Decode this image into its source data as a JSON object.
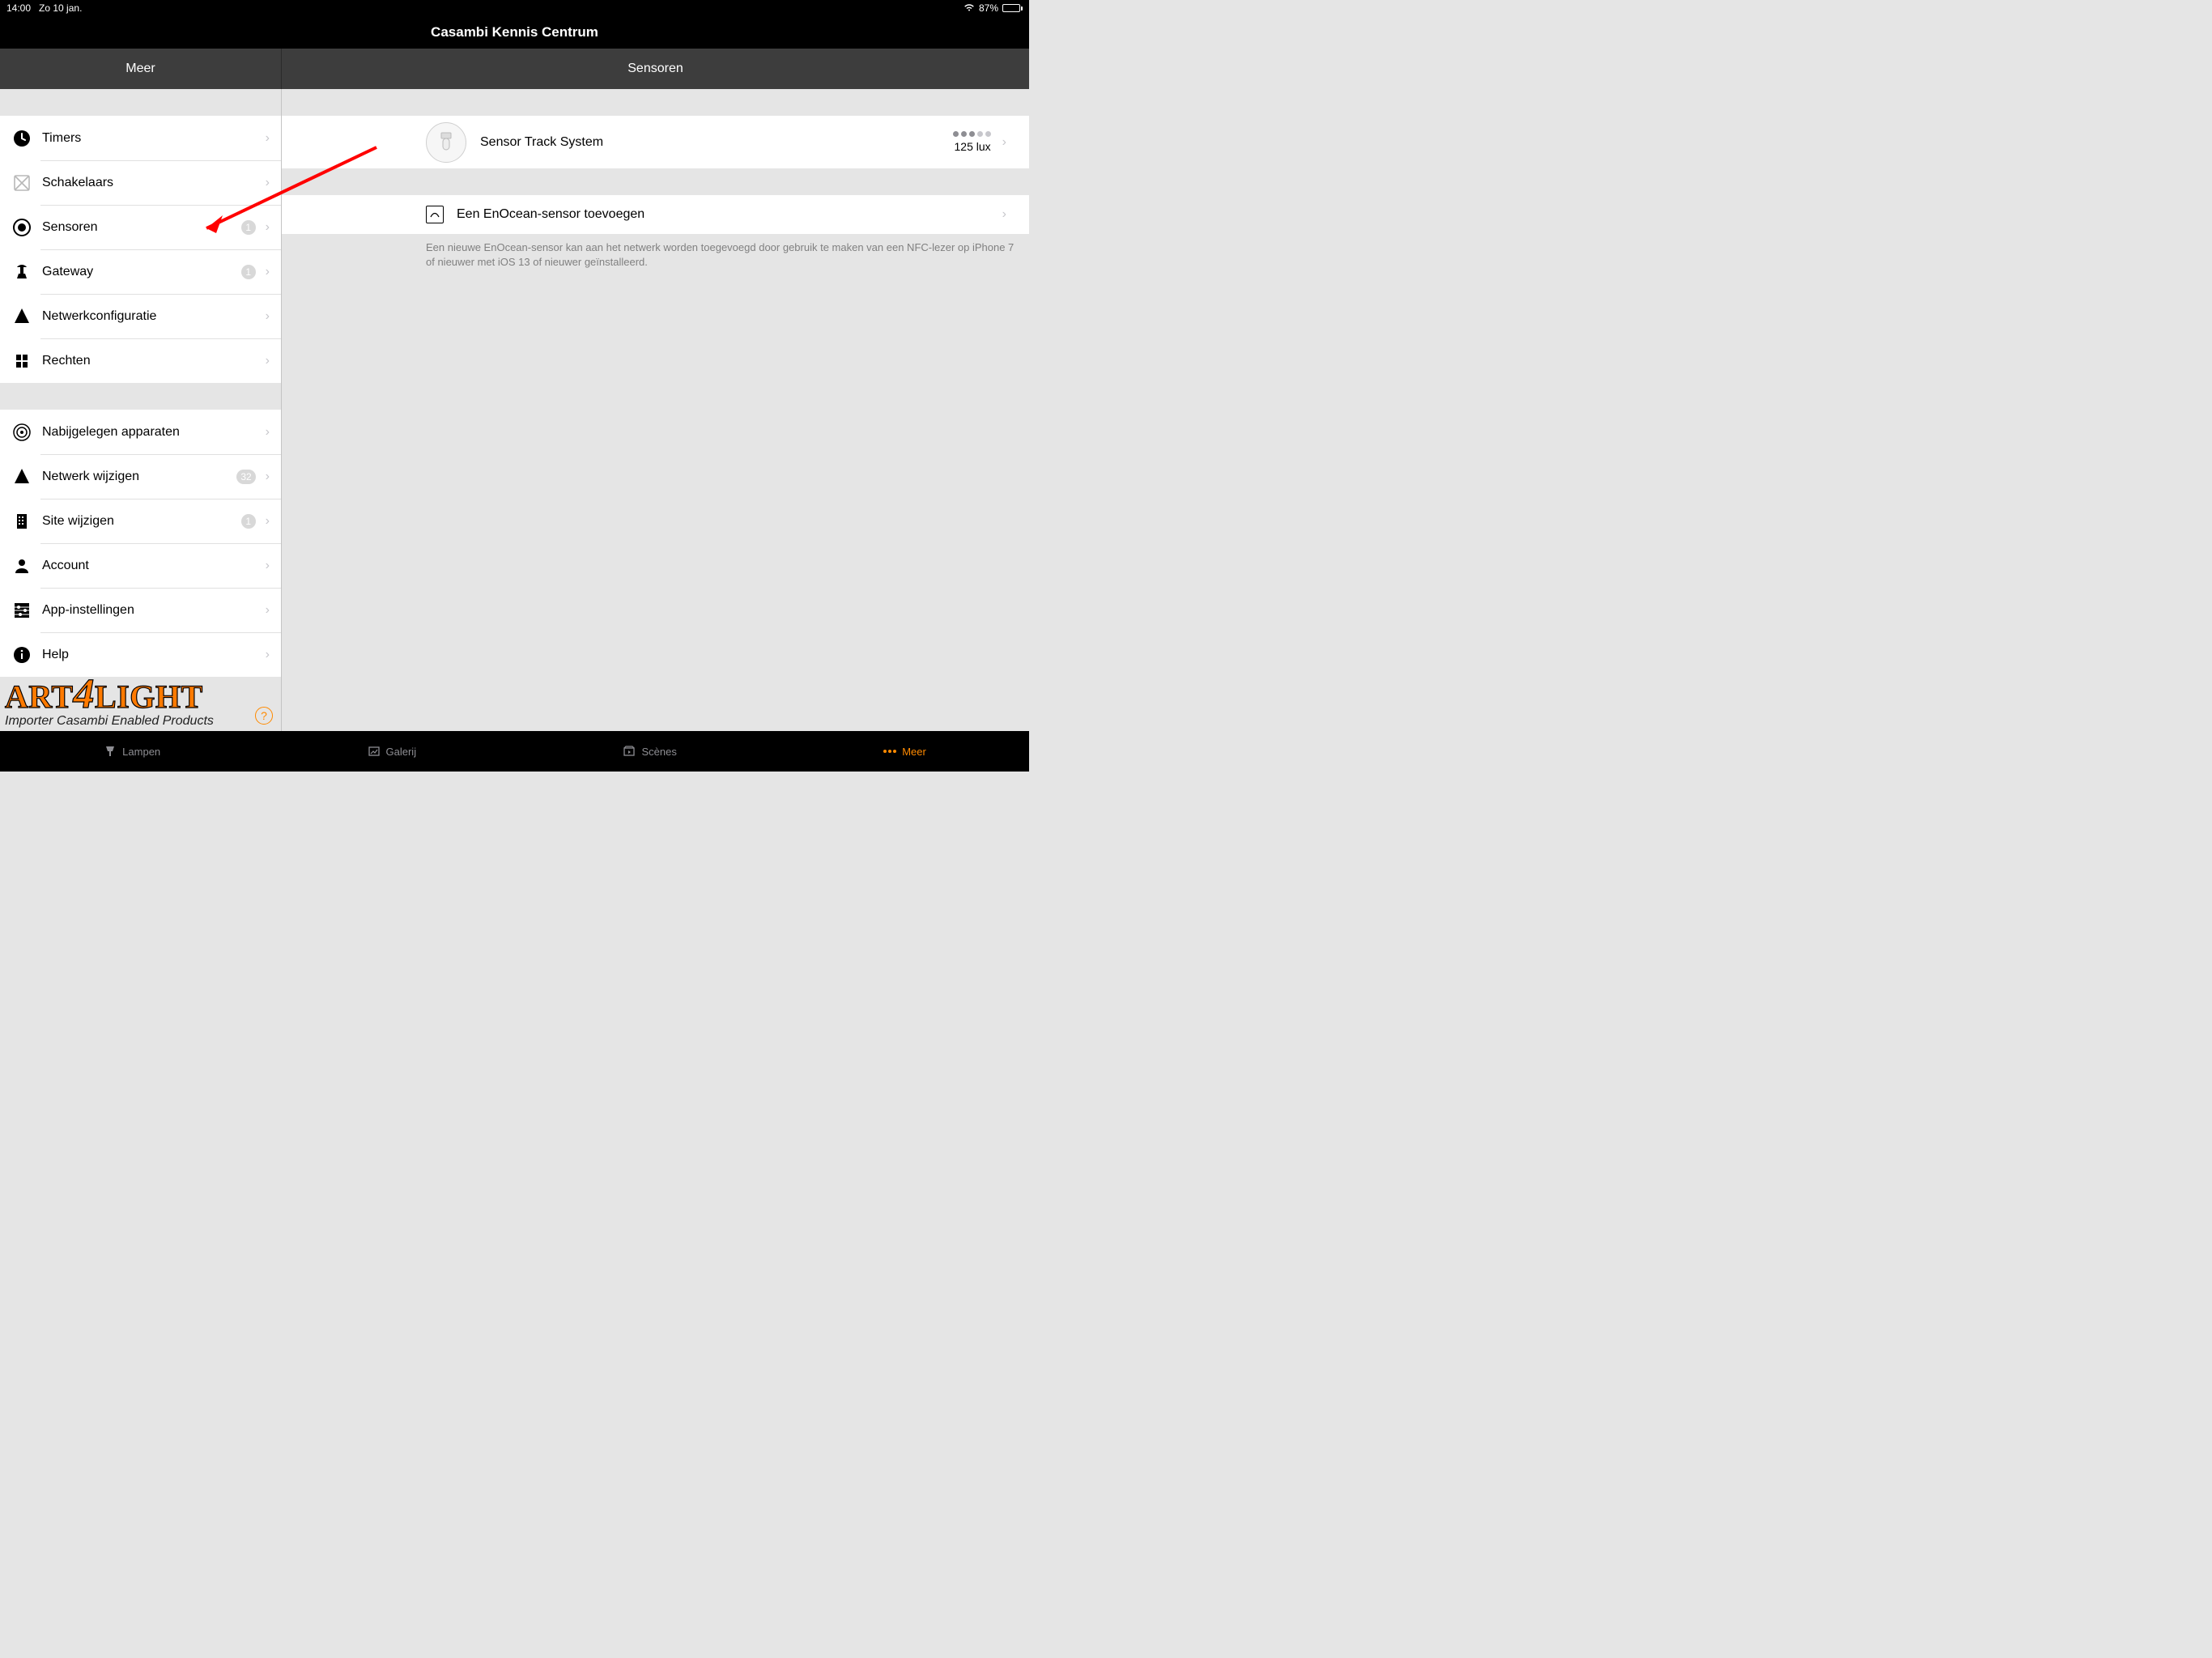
{
  "status": {
    "time": "14:00",
    "date": "Zo 10 jan.",
    "battery": "87%"
  },
  "app": {
    "title": "Casambi Kennis Centrum"
  },
  "sidebar": {
    "title": "Meer",
    "group1": [
      {
        "label": "Timers",
        "badge": ""
      },
      {
        "label": "Schakelaars",
        "badge": ""
      },
      {
        "label": "Sensoren",
        "badge": "1"
      },
      {
        "label": "Gateway",
        "badge": "1"
      },
      {
        "label": "Netwerkconfiguratie",
        "badge": ""
      },
      {
        "label": "Rechten",
        "badge": ""
      }
    ],
    "group2": [
      {
        "label": "Nabijgelegen apparaten",
        "badge": ""
      },
      {
        "label": "Netwerk wijzigen",
        "badge": "32"
      },
      {
        "label": "Site wijzigen",
        "badge": "1"
      },
      {
        "label": "Account",
        "badge": ""
      },
      {
        "label": "App-instellingen",
        "badge": ""
      },
      {
        "label": "Help",
        "badge": ""
      }
    ]
  },
  "main": {
    "title": "Sensoren",
    "sensor": {
      "name": "Sensor Track System",
      "lux": "125 lux",
      "signal_on": 3,
      "signal_total": 5
    },
    "add": {
      "label": "Een EnOcean-sensor toevoegen"
    },
    "note": "Een nieuwe EnOcean-sensor kan aan het netwerk worden toegevoegd door gebruik te maken van een NFC-lezer op iPhone 7 of nieuwer met iOS 13 of nieuwer geïnstalleerd."
  },
  "tabs": [
    {
      "label": "Lampen"
    },
    {
      "label": "Galerij"
    },
    {
      "label": "Scènes"
    },
    {
      "label": "Meer"
    }
  ],
  "logo": {
    "brand": "ART4LIGHT",
    "tagline": "Importer Casambi Enabled Products"
  }
}
